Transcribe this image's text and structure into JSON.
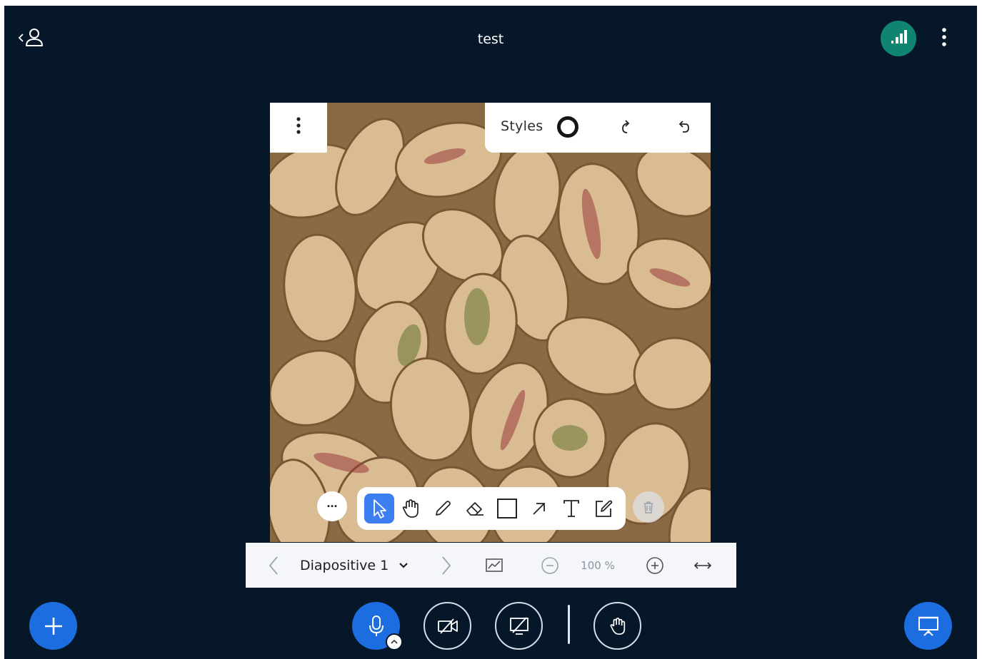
{
  "header": {
    "title": "test",
    "user_list_toggle_icon": "user-list-toggle-icon",
    "connection_status_icon": "signal-bars-icon",
    "options_icon": "vertical-dots-icon",
    "connection_status_color": "#0f8471"
  },
  "whiteboard": {
    "styles_label": "Styles",
    "menu_icon": "vertical-dots-icon",
    "style_swatch": "#151515",
    "redo_icon": "redo-icon",
    "undo_icon": "undo-icon",
    "more_tools_label": "···",
    "tools": [
      {
        "name": "select",
        "icon": "pointer-icon",
        "active": true
      },
      {
        "name": "pan",
        "icon": "hand-icon",
        "active": false
      },
      {
        "name": "draw",
        "icon": "pencil-icon",
        "active": false
      },
      {
        "name": "eraser",
        "icon": "eraser-icon",
        "active": false
      },
      {
        "name": "rectangle",
        "icon": "rectangle-icon",
        "active": false
      },
      {
        "name": "arrow",
        "icon": "arrow-icon",
        "active": false
      },
      {
        "name": "text",
        "icon": "text-icon",
        "active": false
      },
      {
        "name": "note",
        "icon": "note-edit-icon",
        "active": false
      }
    ],
    "delete_icon": "trash-icon",
    "accent_color": "#3d7ef0"
  },
  "presentation_bar": {
    "slide_label": "Diapositive 1",
    "zoom_value": "100 %",
    "prev_icon": "chevron-left-icon",
    "next_icon": "chevron-right-icon",
    "dropdown_icon": "chevron-down-icon",
    "presentation_icon": "chart-slide-icon",
    "zoom_out_icon": "zoom-out-icon",
    "zoom_in_icon": "zoom-in-icon",
    "fit_width_icon": "fit-width-icon"
  },
  "bottom_bar": {
    "actions_icon": "plus-icon",
    "mic_icon": "microphone-icon",
    "audio_settings_icon": "chevron-up-icon",
    "camera_icon": "camera-off-icon",
    "screenshare_icon": "screenshare-off-icon",
    "raise_hand_icon": "hand-icon",
    "presentation_toggle_icon": "presentation-icon",
    "brand_color": "#1b6de0"
  },
  "colors": {
    "background": "#06172a",
    "toolbar_bg": "#ffffff",
    "pres_bar_bg": "#f4f6fa"
  }
}
